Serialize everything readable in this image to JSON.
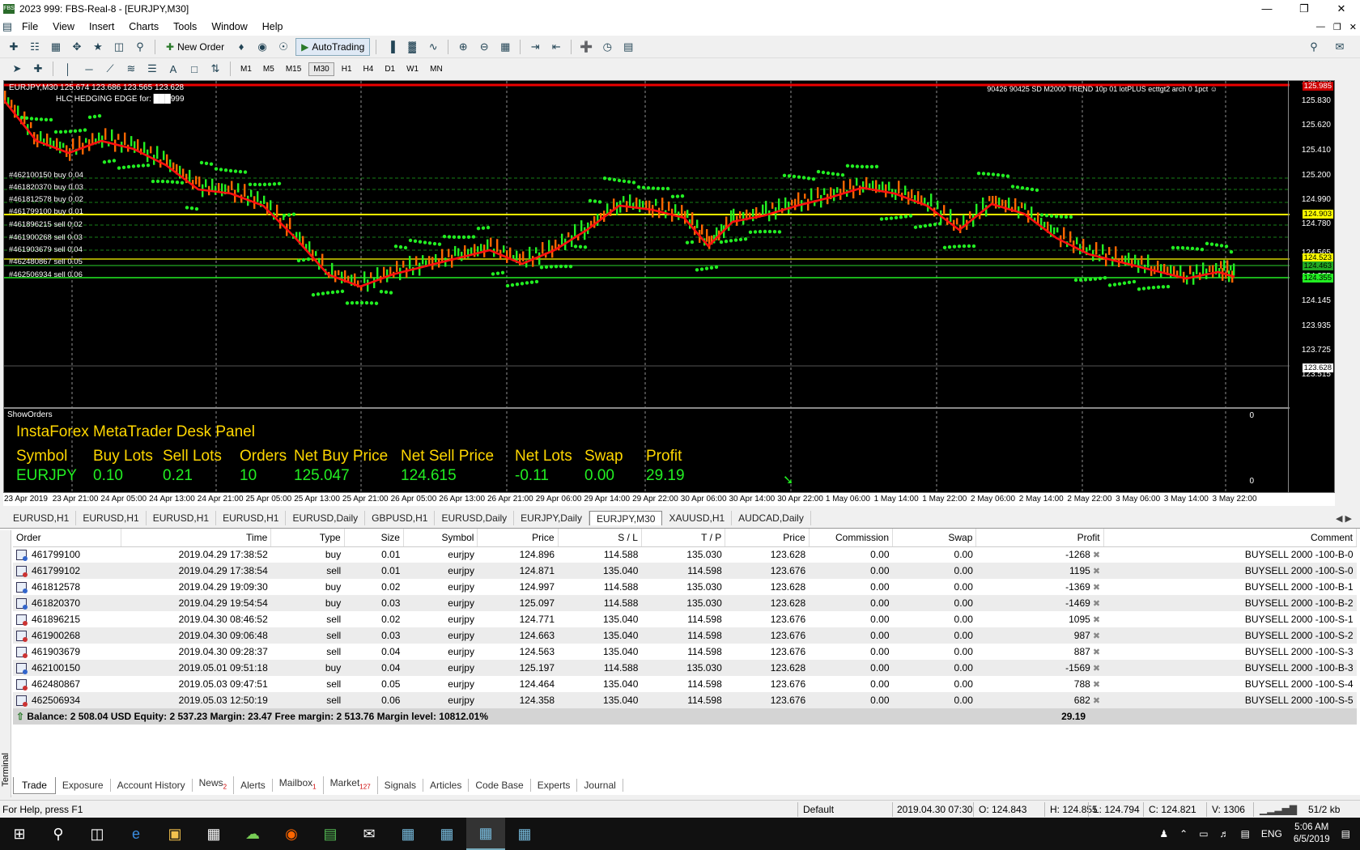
{
  "window": {
    "title": "2023 999: FBS-Real-8 - [EURJPY,M30]",
    "app_icon": "FBS"
  },
  "menu": [
    "File",
    "View",
    "Insert",
    "Charts",
    "Tools",
    "Window",
    "Help"
  ],
  "toolbar": {
    "new_order": "New Order",
    "autotrading": "AutoTrading"
  },
  "timeframes": [
    "M1",
    "M5",
    "M15",
    "M30",
    "H1",
    "H4",
    "D1",
    "W1",
    "MN"
  ],
  "timeframe_selected": "M30",
  "chart": {
    "header": "EURJPY,M30  125.674 123.686 123.565 123.628",
    "subheader": "HLC HEDGING EDGE for: ███999",
    "ea_label": "90426 90425 SD M2000 TREND 10p 01 lotPLUS ecttgt2 arch 0 1pct ☺",
    "order_labels": [
      "#462100150 buy 0.04",
      "#461820370 buy 0.03",
      "#461812578 buy 0.02",
      "#461799100 buy 0.01",
      "#461896215 sell 0.02",
      "#461900268 sell 0.03",
      "#461903679 sell 0.04",
      "#462480867 sell 0.05",
      "#462506934 sell 0.06"
    ],
    "price_ticks": [
      "126.040",
      "125.830",
      "125.620",
      "125.410",
      "125.200",
      "124.990",
      "124.780",
      "124.565",
      "124.355",
      "124.145",
      "123.935",
      "123.725",
      "123.515"
    ],
    "price_tags": [
      {
        "label": "125.985",
        "bg": "#cc0000",
        "fg": "#ffffff"
      },
      {
        "label": "124.903",
        "bg": "#ffff00",
        "fg": "#000000"
      },
      {
        "label": "124.523",
        "bg": "#ffff00",
        "fg": "#000000"
      },
      {
        "label": "124.463",
        "bg": "#22aa22",
        "fg": "#000000"
      },
      {
        "label": "124.355",
        "bg": "#22ee22",
        "fg": "#000000"
      },
      {
        "label": "123.628",
        "bg": "#ffffff",
        "fg": "#000000"
      }
    ],
    "indicator_axis": [
      "0",
      "0"
    ],
    "time_labels": [
      "23 Apr 2019",
      "23 Apr 21:00",
      "24 Apr 05:00",
      "24 Apr 13:00",
      "24 Apr 21:00",
      "25 Apr 05:00",
      "25 Apr 13:00",
      "25 Apr 21:00",
      "26 Apr 05:00",
      "26 Apr 13:00",
      "26 Apr 21:00",
      "29 Apr 06:00",
      "29 Apr 14:00",
      "29 Apr 22:00",
      "30 Apr 06:00",
      "30 Apr 14:00",
      "30 Apr 22:00",
      "1 May 06:00",
      "1 May 14:00",
      "1 May 22:00",
      "2 May 06:00",
      "2 May 14:00",
      "2 May 22:00",
      "3 May 06:00",
      "3 May 14:00",
      "3 May 22:00"
    ],
    "colors": {
      "bull": "#22ee22",
      "ma": "#ff1010",
      "sar": "#22ee22",
      "bear": "#ff6600"
    }
  },
  "desk_panel": {
    "show_orders": "ShowOrders",
    "title": "InstaForex MetaTrader Desk Panel",
    "headers": [
      "Symbol",
      "Buy Lots",
      "Sell Lots",
      "Orders",
      "Net Buy Price",
      "Net Sell Price",
      "Net Lots",
      "Swap",
      "Profit"
    ],
    "values": [
      "EURJPY",
      "0.10",
      "0.21",
      "10",
      "125.047",
      "124.615",
      "-0.11",
      "0.00",
      "29.19"
    ]
  },
  "chart_tabs": [
    "EURUSD,H1",
    "EURUSD,H1",
    "EURUSD,H1",
    "EURUSD,H1",
    "EURUSD,Daily",
    "GBPUSD,H1",
    "EURUSD,Daily",
    "EURJPY,Daily",
    "EURJPY,M30",
    "XAUUSD,H1",
    "AUDCAD,Daily"
  ],
  "chart_tab_active": 8,
  "terminal": {
    "columns": [
      "Order",
      "Time",
      "Type",
      "Size",
      "Symbol",
      "Price",
      "S / L",
      "T / P",
      "Price",
      "Commission",
      "Swap",
      "Profit",
      "Comment"
    ],
    "rows": [
      [
        "461799100",
        "2019.04.29 17:38:52",
        "buy",
        "0.01",
        "eurjpy",
        "124.896",
        "114.588",
        "135.030",
        "123.628",
        "0.00",
        "0.00",
        "-1268",
        "BUYSELL 2000 -100-B-0"
      ],
      [
        "461799102",
        "2019.04.29 17:38:54",
        "sell",
        "0.01",
        "eurjpy",
        "124.871",
        "135.040",
        "114.598",
        "123.676",
        "0.00",
        "0.00",
        "1195",
        "BUYSELL 2000 -100-S-0"
      ],
      [
        "461812578",
        "2019.04.29 19:09:30",
        "buy",
        "0.02",
        "eurjpy",
        "124.997",
        "114.588",
        "135.030",
        "123.628",
        "0.00",
        "0.00",
        "-1369",
        "BUYSELL 2000 -100-B-1"
      ],
      [
        "461820370",
        "2019.04.29 19:54:54",
        "buy",
        "0.03",
        "eurjpy",
        "125.097",
        "114.588",
        "135.030",
        "123.628",
        "0.00",
        "0.00",
        "-1469",
        "BUYSELL 2000 -100-B-2"
      ],
      [
        "461896215",
        "2019.04.30 08:46:52",
        "sell",
        "0.02",
        "eurjpy",
        "124.771",
        "135.040",
        "114.598",
        "123.676",
        "0.00",
        "0.00",
        "1095",
        "BUYSELL 2000 -100-S-1"
      ],
      [
        "461900268",
        "2019.04.30 09:06:48",
        "sell",
        "0.03",
        "eurjpy",
        "124.663",
        "135.040",
        "114.598",
        "123.676",
        "0.00",
        "0.00",
        "987",
        "BUYSELL 2000 -100-S-2"
      ],
      [
        "461903679",
        "2019.04.30 09:28:37",
        "sell",
        "0.04",
        "eurjpy",
        "124.563",
        "135.040",
        "114.598",
        "123.676",
        "0.00",
        "0.00",
        "887",
        "BUYSELL 2000 -100-S-3"
      ],
      [
        "462100150",
        "2019.05.01 09:51:18",
        "buy",
        "0.04",
        "eurjpy",
        "125.197",
        "114.588",
        "135.030",
        "123.628",
        "0.00",
        "0.00",
        "-1569",
        "BUYSELL 2000 -100-B-3"
      ],
      [
        "462480867",
        "2019.05.03 09:47:51",
        "sell",
        "0.05",
        "eurjpy",
        "124.464",
        "135.040",
        "114.598",
        "123.676",
        "0.00",
        "0.00",
        "788",
        "BUYSELL 2000 -100-S-4"
      ],
      [
        "462506934",
        "2019.05.03 12:50:19",
        "sell",
        "0.06",
        "eurjpy",
        "124.358",
        "135.040",
        "114.598",
        "123.676",
        "0.00",
        "0.00",
        "682",
        "BUYSELL 2000 -100-S-5"
      ]
    ],
    "balance": "Balance: 2 508.04 USD  Equity: 2 537.23  Margin: 23.47  Free margin: 2 513.76  Margin level: 10812.01%",
    "total_profit": "29.19",
    "side_label": "Terminal",
    "tabs": [
      {
        "label": "Trade",
        "badge": ""
      },
      {
        "label": "Exposure",
        "badge": ""
      },
      {
        "label": "Account History",
        "badge": ""
      },
      {
        "label": "News",
        "badge": "2"
      },
      {
        "label": "Alerts",
        "badge": ""
      },
      {
        "label": "Mailbox",
        "badge": "1"
      },
      {
        "label": "Market",
        "badge": "127"
      },
      {
        "label": "Signals",
        "badge": ""
      },
      {
        "label": "Articles",
        "badge": ""
      },
      {
        "label": "Code Base",
        "badge": ""
      },
      {
        "label": "Experts",
        "badge": ""
      },
      {
        "label": "Journal",
        "badge": ""
      }
    ]
  },
  "status": {
    "help": "For Help, press F1",
    "profile": "Default",
    "time": "2019.04.30 07:30",
    "open": "O: 124.843",
    "high": "H: 124.855",
    "low": "L: 124.794",
    "close": "C: 124.821",
    "volume": "V: 1306",
    "traffic": "51/2 kb"
  },
  "taskbar": {
    "lang": "ENG",
    "time": "5:06 AM",
    "date": "6/5/2019"
  }
}
